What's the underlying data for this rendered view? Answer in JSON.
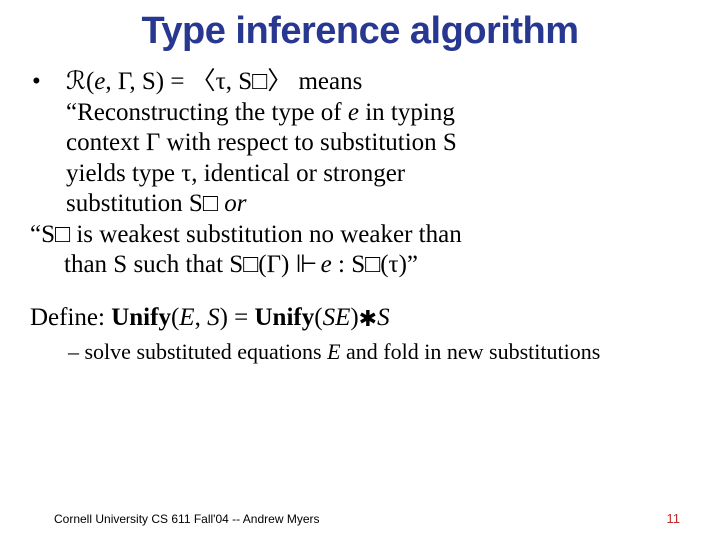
{
  "title": "Type inference algorithm",
  "bullet": {
    "line1_pre": "ℛ(",
    "line1_e": "e",
    "line1_mid": ", Γ, S) = 〈τ, S□〉 means",
    "line2": "“Reconstructing the type of ",
    "line2_e": "e",
    "line2_post": " in typing",
    "line3": "context Γ with respect to substitution S",
    "line4": "yields type τ, identical or stronger",
    "line5_a": "substitution S□ ",
    "line5_or": "or",
    "line6": "“S□ is weakest substitution no weaker than",
    "line7_a": "than S such that ",
    "line7_b": "S□(Γ) ",
    "line7_turn": "⊩",
    "line7_c": " e",
    "line7_d": " : S□(τ)",
    "line7_e": "”"
  },
  "define": {
    "pre": "Define: ",
    "unify1": "Unify",
    "args1_a": "(",
    "args1_E": "E",
    "args1_b": ", ",
    "args1_S": "S",
    "args1_c": ") = ",
    "unify2": "Unify",
    "args2_a": "(",
    "args2_SE": "SE",
    "args2_b": ")",
    "compose": "✱",
    "args2_S": "S"
  },
  "sub": {
    "dash": "– ",
    "text_a": "solve substituted equations ",
    "text_E": "E",
    "text_b": " and fold in new substitutions"
  },
  "footer": {
    "left": "Cornell University CS 611 Fall'04 -- Andrew Myers",
    "right": "11"
  }
}
